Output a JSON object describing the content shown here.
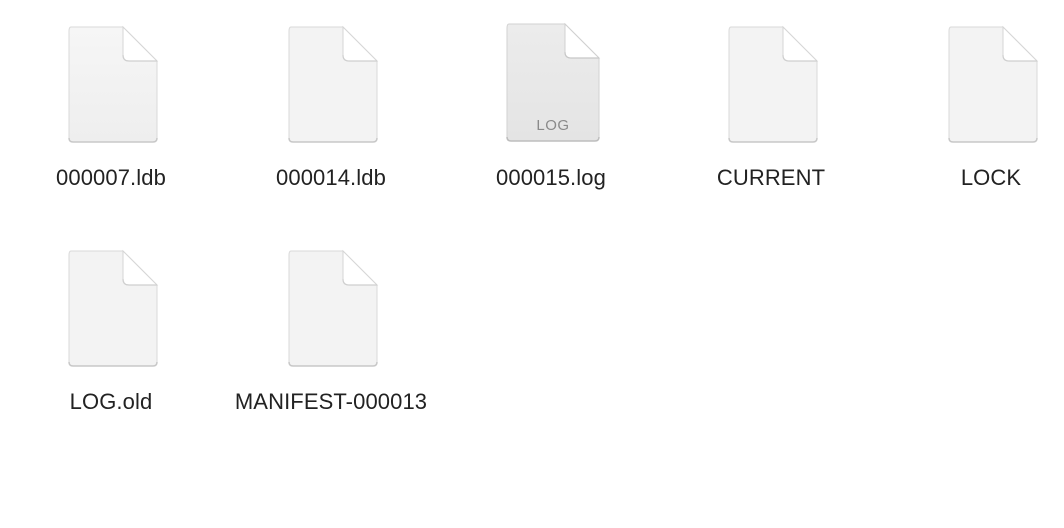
{
  "files": [
    {
      "name": "000007.ldb",
      "icon": "document-icon",
      "type_tag": ""
    },
    {
      "name": "000014.ldb",
      "icon": "document-icon",
      "type_tag": ""
    },
    {
      "name": "000015.log",
      "icon": "log-document-icon",
      "type_tag": "LOG"
    },
    {
      "name": "CURRENT",
      "icon": "document-icon",
      "type_tag": ""
    },
    {
      "name": "LOCK",
      "icon": "document-icon",
      "type_tag": ""
    },
    {
      "name": "LOG.old",
      "icon": "document-icon",
      "type_tag": ""
    },
    {
      "name": "MANIFEST-000013",
      "icon": "document-icon",
      "type_tag": ""
    }
  ]
}
